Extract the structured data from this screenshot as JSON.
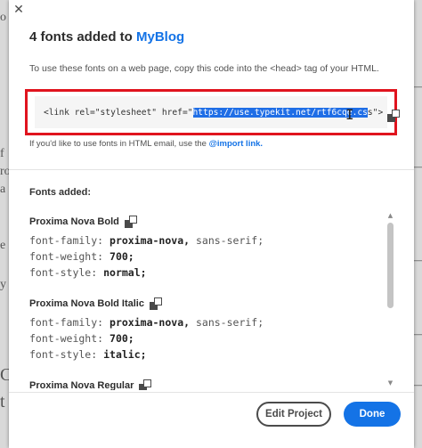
{
  "dialog": {
    "close_glyph": "✕",
    "title_prefix": "4 fonts added to",
    "title_project": "MyBlog",
    "instructions": "To use these fonts on a web page, copy this code into the <head> tag of your HTML.",
    "embed": {
      "code_before": "<link rel=\"stylesheet\" href=\"",
      "code_selected": "https://use.typekit.net/rtf6cqe.cs",
      "code_after": "s\">"
    },
    "email_note_prefix": "If you'd like to use fonts in HTML email, use the",
    "email_link": "@import link.",
    "fonts_added_label": "Fonts added:",
    "fonts": [
      {
        "name": "Proxima Nova Bold",
        "family_key": "font-family:",
        "family_val": "proxima-nova,",
        "family_fallback": "sans-serif;",
        "weight_key": "font-weight:",
        "weight_val": "700;",
        "style_key": "font-style:",
        "style_val": "normal;"
      },
      {
        "name": "Proxima Nova Bold Italic",
        "family_key": "font-family:",
        "family_val": "proxima-nova,",
        "family_fallback": "sans-serif;",
        "weight_key": "font-weight:",
        "weight_val": "700;",
        "style_key": "font-style:",
        "style_val": "italic;"
      },
      {
        "name": "Proxima Nova Regular"
      }
    ],
    "buttons": {
      "edit_project": "Edit Project",
      "done": "Done"
    }
  },
  "background": {
    "left_chars": [
      "o",
      "f",
      "ro",
      "a",
      "e",
      "y",
      "C",
      "t"
    ],
    "right_chars": [
      "—",
      "—",
      "—",
      "—",
      "—"
    ]
  },
  "colors": {
    "accent": "#1473e6",
    "highlight_border": "#e0141e",
    "selection": "#1f6ee6"
  }
}
